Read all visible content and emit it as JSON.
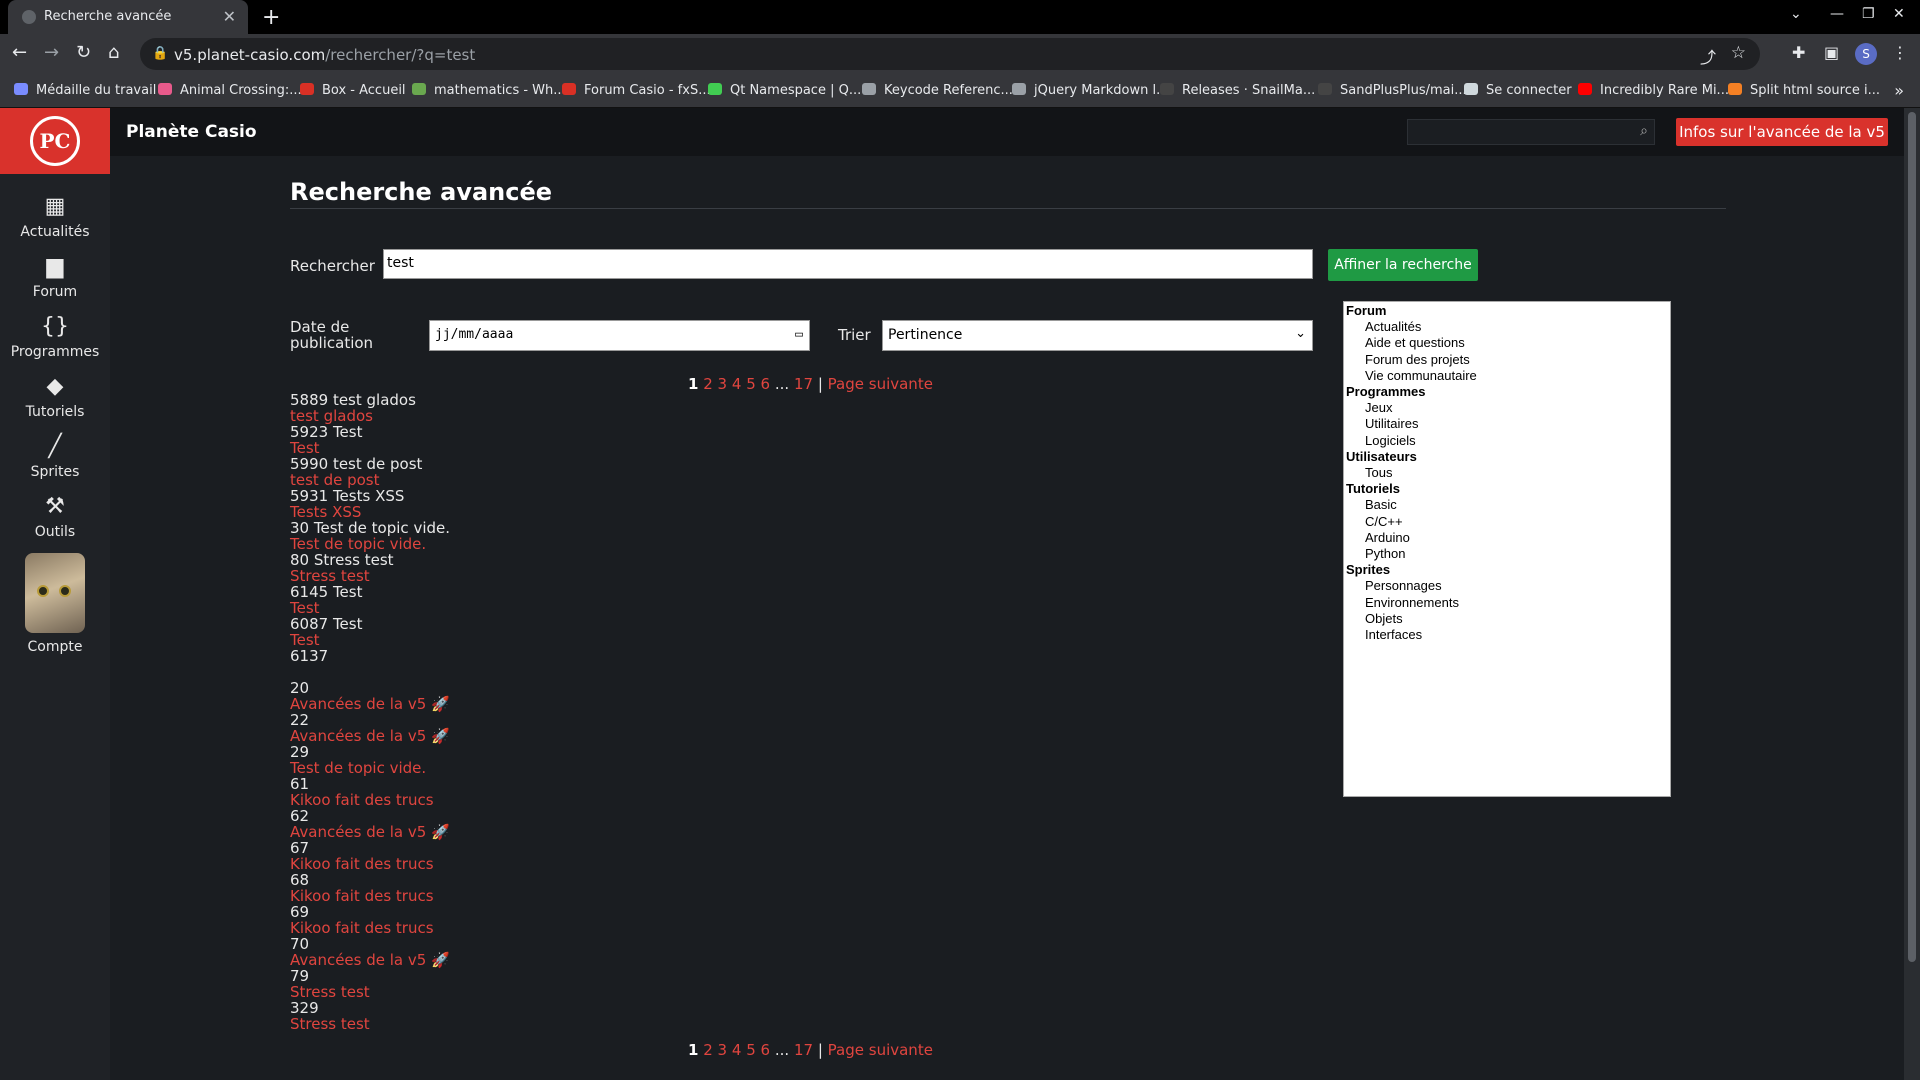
{
  "browser": {
    "tab_title": "Recherche avancée",
    "url_host": "v5.planet-casio.com",
    "url_path": "/rechercher/?q=test",
    "profile_initial": "S",
    "bookmarks": [
      {
        "label": "Médaille du travail",
        "color": "#7a8cff"
      },
      {
        "label": "Animal Crossing:...",
        "color": "#e85a8b"
      },
      {
        "label": "Box - Accueil",
        "color": "#d93025"
      },
      {
        "label": "mathematics - Wh...",
        "color": "#6aa84f"
      },
      {
        "label": "Forum Casio - fxS...",
        "color": "#d93025"
      },
      {
        "label": "Qt Namespace | Q...",
        "color": "#41cd52"
      },
      {
        "label": "Keycode Referenc...",
        "color": "#9aa0a6"
      },
      {
        "label": "jQuery Markdown l...",
        "color": "#9aa0a6"
      },
      {
        "label": "Releases · SnailMa...",
        "color": "#444"
      },
      {
        "label": "SandPlusPlus/mai...",
        "color": "#444"
      },
      {
        "label": "Se connecter",
        "color": "#cfd8dc"
      },
      {
        "label": "Incredibly Rare Mi...",
        "color": "#ff0000"
      },
      {
        "label": "Split html source i...",
        "color": "#f48024"
      }
    ]
  },
  "sidebar": {
    "logo": "PC",
    "items": [
      {
        "label": "Actualités",
        "icon": "calendar-icon",
        "glyph": "▦"
      },
      {
        "label": "Forum",
        "icon": "chat-icon",
        "glyph": "▆"
      },
      {
        "label": "Programmes",
        "icon": "braces-icon",
        "glyph": "{}"
      },
      {
        "label": "Tutoriels",
        "icon": "graduation-cap-icon",
        "glyph": "◆"
      },
      {
        "label": "Sprites",
        "icon": "brush-icon",
        "glyph": "╱"
      },
      {
        "label": "Outils",
        "icon": "wrench-icon",
        "glyph": "⚒"
      }
    ],
    "account_label": "Compte"
  },
  "header": {
    "site_title": "Planète Casio",
    "search_value": "",
    "v5_button": "Infos sur l'avancée de la v5"
  },
  "page": {
    "title": "Recherche avancée",
    "search_label": "Rechercher",
    "search_value": "test",
    "refine_button": "Affiner la recherche",
    "date_label_line1": "Date de",
    "date_label_line2": "publication",
    "date_placeholder": "jj/mm/aaaa",
    "sort_label": "Trier",
    "sort_value": "Pertinence"
  },
  "categories": [
    {
      "group": "Forum",
      "options": [
        "Actualités",
        "Aide et questions",
        "Forum des projets",
        "Vie communautaire"
      ]
    },
    {
      "group": "Programmes",
      "options": [
        "Jeux",
        "Utilitaires",
        "Logiciels"
      ]
    },
    {
      "group": "Utilisateurs",
      "options": [
        "Tous"
      ]
    },
    {
      "group": "Tutoriels",
      "options": [
        "Basic",
        "C/C++",
        "Arduino",
        "Python"
      ]
    },
    {
      "group": "Sprites",
      "options": [
        "Personnages",
        "Environnements",
        "Objets",
        "Interfaces"
      ]
    }
  ],
  "pagination": {
    "current": "1",
    "pages": [
      "2",
      "3",
      "4",
      "5",
      "6"
    ],
    "ellipsis": "...",
    "last": "17",
    "separator": "|",
    "next": "Page suivante"
  },
  "results": [
    {
      "kind": "plain",
      "text": "5889 test glados"
    },
    {
      "kind": "link",
      "text": "test glados"
    },
    {
      "kind": "plain",
      "text": "5923 Test"
    },
    {
      "kind": "link",
      "text": "Test"
    },
    {
      "kind": "plain",
      "text": "5990 test de post"
    },
    {
      "kind": "link",
      "text": "test de post"
    },
    {
      "kind": "plain",
      "text": "5931 Tests XSS"
    },
    {
      "kind": "link",
      "text": "Tests XSS"
    },
    {
      "kind": "plain",
      "text": "30 Test de topic vide."
    },
    {
      "kind": "link",
      "text": "Test de topic vide."
    },
    {
      "kind": "plain",
      "text": "80 Stress test"
    },
    {
      "kind": "link",
      "text": "Stress test"
    },
    {
      "kind": "plain",
      "text": "6145 Test"
    },
    {
      "kind": "link",
      "text": "Test"
    },
    {
      "kind": "plain",
      "text": "6087 Test"
    },
    {
      "kind": "link",
      "text": "Test"
    },
    {
      "kind": "plain",
      "text": "6137"
    },
    {
      "kind": "blank",
      "text": ""
    },
    {
      "kind": "plain",
      "text": "20"
    },
    {
      "kind": "link",
      "text": "Avancées de la v5 🚀"
    },
    {
      "kind": "plain",
      "text": "22"
    },
    {
      "kind": "link",
      "text": "Avancées de la v5 🚀"
    },
    {
      "kind": "plain",
      "text": "29"
    },
    {
      "kind": "link",
      "text": "Test de topic vide."
    },
    {
      "kind": "plain",
      "text": "61"
    },
    {
      "kind": "link",
      "text": "Kikoo fait des trucs"
    },
    {
      "kind": "plain",
      "text": "62"
    },
    {
      "kind": "link",
      "text": "Avancées de la v5 🚀"
    },
    {
      "kind": "plain",
      "text": "67"
    },
    {
      "kind": "link",
      "text": "Kikoo fait des trucs"
    },
    {
      "kind": "plain",
      "text": "68"
    },
    {
      "kind": "link",
      "text": "Kikoo fait des trucs"
    },
    {
      "kind": "plain",
      "text": "69"
    },
    {
      "kind": "link",
      "text": "Kikoo fait des trucs"
    },
    {
      "kind": "plain",
      "text": "70"
    },
    {
      "kind": "link",
      "text": "Avancées de la v5 🚀"
    },
    {
      "kind": "plain",
      "text": "79"
    },
    {
      "kind": "link",
      "text": "Stress test"
    },
    {
      "kind": "plain",
      "text": "329"
    },
    {
      "kind": "link",
      "text": "Stress test"
    }
  ],
  "colors": {
    "brand_red": "#d9322c",
    "link_red": "#e0453f",
    "refine_green": "#1f9a44"
  }
}
